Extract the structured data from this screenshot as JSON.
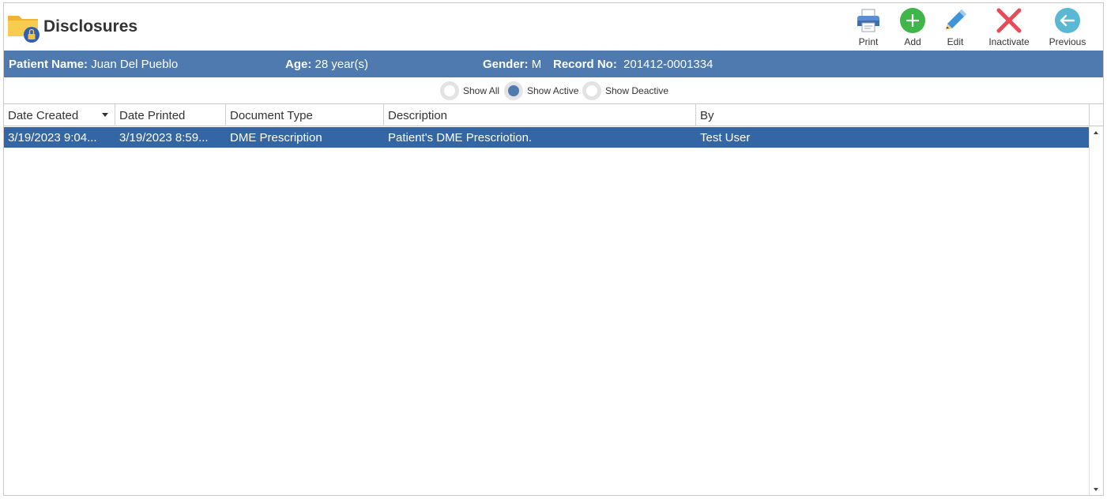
{
  "header": {
    "title": "Disclosures",
    "icon": "folder-lock-icon"
  },
  "toolbar": {
    "print": {
      "label": "Print",
      "icon": "printer-icon"
    },
    "add": {
      "label": "Add",
      "icon": "plus-icon",
      "color": "#3fb54a"
    },
    "edit": {
      "label": "Edit",
      "icon": "pencil-icon"
    },
    "inactivate": {
      "label": "Inactivate",
      "icon": "close-icon",
      "color": "#ea4a57"
    },
    "previous": {
      "label": "Previous",
      "icon": "arrow-left-icon",
      "color": "#5bb8d4"
    }
  },
  "patient": {
    "name_label": "Patient Name:",
    "name": "Juan Del Pueblo",
    "age_label": "Age:",
    "age": "28 year(s)",
    "gender_label": "Gender:",
    "gender": "M",
    "record_label": "Record No:",
    "record": "201412-0001334",
    "bar_color": "#4e7ab0"
  },
  "filters": {
    "all": "Show All",
    "active": "Show Active",
    "deactive": "Show Deactive",
    "selected": "active"
  },
  "grid": {
    "columns": [
      "Date Created",
      "Date Printed",
      "Document Type",
      "Description",
      "By"
    ],
    "rows": [
      [
        "3/19/2023 9:04...",
        "3/19/2023 8:59...",
        "DME Prescription",
        "Patient's DME Prescriotion.",
        "Test User"
      ]
    ],
    "selected_row_color": "#3465a4"
  }
}
